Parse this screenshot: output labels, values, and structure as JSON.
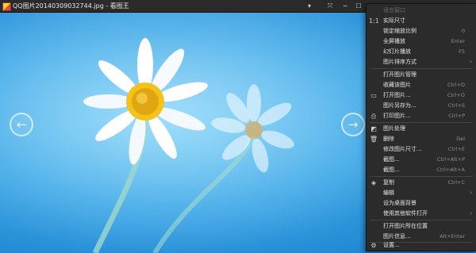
{
  "window": {
    "title": "QQ图片20140309032744.jpg - 看图王",
    "controls": {
      "dropdown": "▾",
      "fit": "⤧",
      "minimize": "−",
      "maximize": "☐"
    }
  },
  "viewer": {
    "image_desc_colors": {
      "sky_light": "#7fd0f5",
      "sky_dark": "#1a77be"
    },
    "prev_arrow": "←",
    "next_arrow": "→"
  },
  "menu": {
    "items": [
      {
        "label": "适合窗口",
        "shortcut": "",
        "icon": "",
        "disabled": true,
        "submenu": false
      },
      {
        "label": "实际尺寸",
        "shortcut": "",
        "icon": "1:1",
        "disabled": false,
        "submenu": false
      },
      {
        "label": "锁定缩放比例",
        "shortcut": "0",
        "icon": "",
        "disabled": false,
        "submenu": false
      },
      {
        "label": "全屏播放",
        "shortcut": "Enter",
        "icon": "",
        "disabled": false,
        "submenu": false
      },
      {
        "label": "幻灯片播放",
        "shortcut": "F5",
        "icon": "",
        "disabled": false,
        "submenu": false
      },
      {
        "label": "图片排序方式",
        "shortcut": "",
        "icon": "",
        "disabled": false,
        "submenu": true
      },
      {
        "label": "打开图片管理",
        "shortcut": "",
        "icon": "",
        "disabled": false,
        "submenu": false
      },
      {
        "label": "收藏该图片",
        "shortcut": "Ctrl+D",
        "icon": "",
        "disabled": false,
        "submenu": false
      },
      {
        "label": "打开图片...",
        "shortcut": "Ctrl+O",
        "icon": "▭",
        "disabled": false,
        "submenu": false
      },
      {
        "label": "图片另存为...",
        "shortcut": "Ctrl+S",
        "icon": "",
        "disabled": false,
        "submenu": false
      },
      {
        "label": "打印图片...",
        "shortcut": "Ctrl+P",
        "icon": "⎙",
        "disabled": false,
        "submenu": false
      },
      {
        "label": "图片处理",
        "shortcut": "",
        "icon": "◩",
        "disabled": false,
        "submenu": false
      },
      {
        "label": "删除",
        "shortcut": "Del",
        "icon": "🗑",
        "disabled": false,
        "submenu": false
      },
      {
        "label": "修改图片尺寸...",
        "shortcut": "Ctrl+E",
        "icon": "",
        "disabled": false,
        "submenu": false
      },
      {
        "label": "截图...",
        "shortcut": "Ctrl+Alt+P",
        "icon": "",
        "disabled": false,
        "submenu": false
      },
      {
        "label": "截图...",
        "shortcut": "Ctrl+Alt+A",
        "icon": "",
        "disabled": false,
        "submenu": false
      },
      {
        "label": "复制",
        "shortcut": "Ctrl+C",
        "icon": "◈",
        "disabled": false,
        "submenu": false
      },
      {
        "label": "编辑",
        "shortcut": "",
        "icon": "",
        "disabled": false,
        "submenu": true
      },
      {
        "label": "设为桌面背景",
        "shortcut": "",
        "icon": "",
        "disabled": false,
        "submenu": false
      },
      {
        "label": "使用其他软件打开",
        "shortcut": "",
        "icon": "",
        "disabled": false,
        "submenu": true
      },
      {
        "label": "打开图片所在位置",
        "shortcut": "",
        "icon": "",
        "disabled": false,
        "submenu": false
      },
      {
        "label": "图片信息...",
        "shortcut": "Alt+Enter",
        "icon": "",
        "disabled": false,
        "submenu": false
      },
      {
        "label": "设置...",
        "shortcut": "",
        "icon": "⚙",
        "disabled": false,
        "submenu": false
      }
    ],
    "submenu_arrow": "›"
  }
}
